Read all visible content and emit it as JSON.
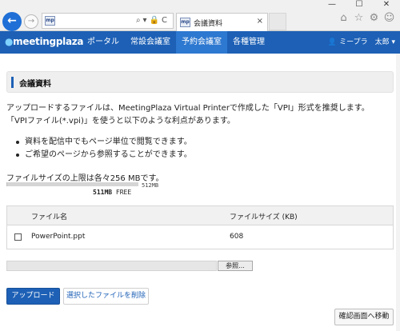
{
  "browser": {
    "window_controls": [
      "—",
      "☐",
      "✕"
    ],
    "address_favicon": "mp",
    "address_icons": "⌕▾🔒C",
    "tab_favicon": "mp",
    "tab_title": "会議資料",
    "tab_close": "×",
    "toolbar_icons": [
      "home-icon",
      "star-icon",
      "gear-icon",
      "smiley-icon"
    ]
  },
  "app": {
    "logo_prefix": "●",
    "logo_text": "meetingplaza",
    "nav": [
      {
        "label": "ポータル",
        "active": false
      },
      {
        "label": "常設会議室",
        "active": false
      },
      {
        "label": "予約会議室",
        "active": true
      },
      {
        "label": "各種管理",
        "active": false
      }
    ],
    "user_name": "ミープラ　太郎",
    "user_caret": "▾"
  },
  "page": {
    "title": "会議資料",
    "desc_line1": "アップロードするファイルは、MeetingPlaza Virtual Printerで作成した「VPI」形式を推奨します。",
    "desc_line2": "「VPIファイル(*.vpi)」を使うと以下のような利点があります。",
    "bullets": [
      "資料を配信中でもページ単位で閲覧できます。",
      "ご希望のページから参照することができます。"
    ],
    "limit_text": "ファイルサイズの上限は各々256 MBです。",
    "quota_used_fraction": 0.002,
    "quota_total": "512MB",
    "quota_free_value": "511MB",
    "quota_free_label": "FREE"
  },
  "table": {
    "headers": [
      "ファイル名",
      "ファイルサイズ (KB)"
    ],
    "rows": [
      {
        "name": "PowerPoint.ppt",
        "size": "608"
      }
    ]
  },
  "actions": {
    "browse_label": "参照...",
    "upload_label": "アップロード",
    "delete_label": "選択したファイルを削除",
    "confirm_label": "確認画面へ移動"
  },
  "colors": {
    "brand": "#1d60b6",
    "nav_active": "#2d78d0"
  }
}
